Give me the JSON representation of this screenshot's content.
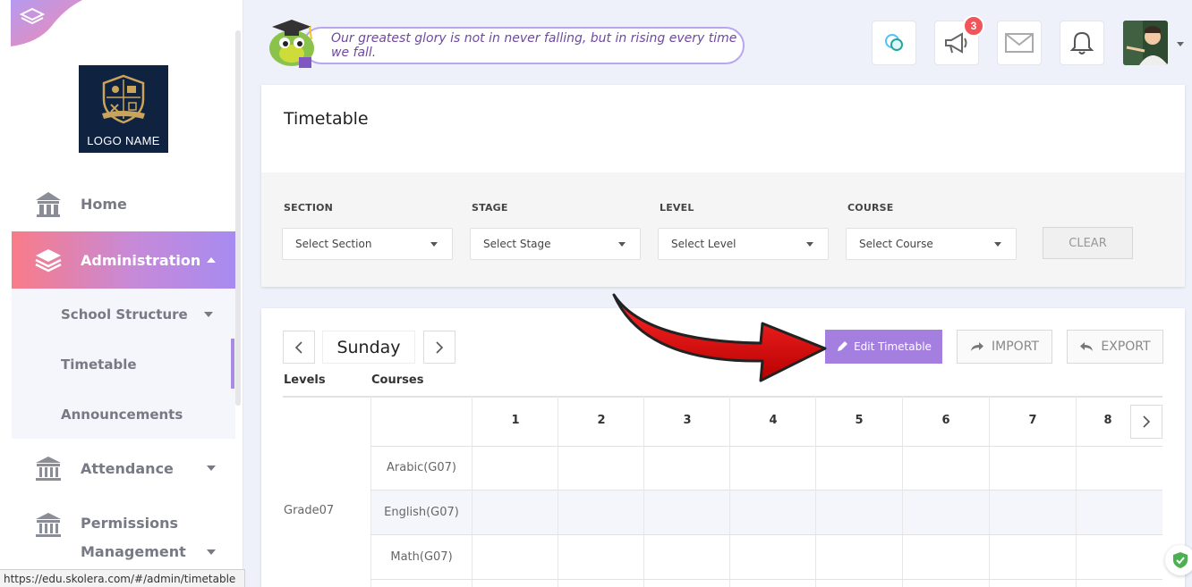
{
  "sidebar": {
    "logo_text": "LOGO NAME",
    "items": [
      {
        "label": "Home",
        "icon": "home-building-icon"
      },
      {
        "label": "Administration",
        "icon": "layers-icon"
      },
      {
        "label": "Attendance",
        "icon": "institution-icon"
      },
      {
        "label": "Permissions Management",
        "icon": "institution-icon"
      }
    ],
    "sub_items": [
      {
        "label": "School Structure"
      },
      {
        "label": "Timetable"
      },
      {
        "label": "Announcements"
      }
    ],
    "permissions_line1": "Permissions",
    "permissions_line2": "Management"
  },
  "topbar": {
    "quote": "Our greatest glory is not in never falling, but in rising every time we fall.",
    "notification_count": "3",
    "icons": [
      "chat-icon",
      "megaphone-icon",
      "mail-icon",
      "bell-icon"
    ]
  },
  "filters": {
    "title": "Timetable",
    "fields": [
      {
        "label": "SECTION",
        "placeholder": "Select Section"
      },
      {
        "label": "STAGE",
        "placeholder": "Select Stage"
      },
      {
        "label": "LEVEL",
        "placeholder": "Select Level"
      },
      {
        "label": "COURSE",
        "placeholder": "Select Course"
      }
    ],
    "clear_label": "CLEAR"
  },
  "timetable": {
    "day": "Sunday",
    "edit_label": "Edit Timetable",
    "import_label": "IMPORT",
    "export_label": "EXPORT",
    "levels_header": "Levels",
    "courses_header": "Courses",
    "periods": [
      "1",
      "2",
      "3",
      "4",
      "5",
      "6",
      "7",
      "8"
    ],
    "level": "Grade07",
    "courses": [
      "Arabic(G07)",
      "English(G07)",
      "Math(G07)"
    ]
  },
  "statusbar": {
    "url": "https://edu.skolera.com/#/admin/timetable"
  },
  "colors": {
    "accent": "#a47fe0",
    "nav_gradient_start": "#f97b88",
    "nav_gradient_end": "#a78bf0",
    "badge": "#f2545b",
    "arrow": "#e00000"
  }
}
